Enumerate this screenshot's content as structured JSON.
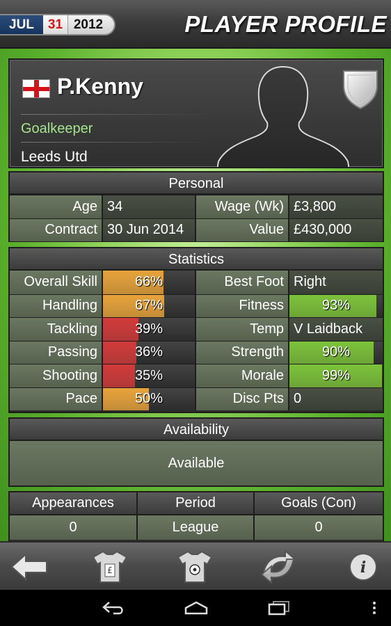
{
  "header": {
    "date": {
      "month": "JUL",
      "day": "31",
      "year": "2012"
    },
    "title": "PLAYER PROFILE"
  },
  "profile": {
    "name": "P.Kenny",
    "nationality_icon": "england-flag-icon",
    "position": "Goalkeeper",
    "club": "Leeds Utd"
  },
  "personal": {
    "title": "Personal",
    "rows": [
      {
        "l1": "Age",
        "v1": "34",
        "l2": "Wage (Wk)",
        "v2": "£3,800"
      },
      {
        "l1": "Contract",
        "v1": "30 Jun 2014",
        "l2": "Value",
        "v2": "£430,000"
      }
    ]
  },
  "statistics": {
    "title": "Statistics",
    "rows": [
      {
        "l1": "Overall Skill",
        "v1": "66%",
        "p1": 66,
        "c1": "#e8a33a",
        "l2": "Best Foot",
        "v2": "Right",
        "p2": null,
        "c2": ""
      },
      {
        "l1": "Handling",
        "v1": "67%",
        "p1": 67,
        "c1": "#e8a33a",
        "l2": "Fitness",
        "v2": "93%",
        "p2": 93,
        "c2": "#7cc23a"
      },
      {
        "l1": "Tackling",
        "v1": "39%",
        "p1": 39,
        "c1": "#d23a3a",
        "l2": "Temp",
        "v2": "V Laidback",
        "p2": null,
        "c2": ""
      },
      {
        "l1": "Passing",
        "v1": "36%",
        "p1": 36,
        "c1": "#d23a3a",
        "l2": "Strength",
        "v2": "90%",
        "p2": 90,
        "c2": "#7cc23a"
      },
      {
        "l1": "Shooting",
        "v1": "35%",
        "p1": 35,
        "c1": "#d23a3a",
        "l2": "Morale",
        "v2": "99%",
        "p2": 99,
        "c2": "#7cc23a"
      },
      {
        "l1": "Pace",
        "v1": "50%",
        "p1": 50,
        "c1": "#e8a33a",
        "l2": "Disc Pts",
        "v2": "0",
        "p2": null,
        "c2": ""
      }
    ]
  },
  "availability": {
    "title": "Availability",
    "status": "Available"
  },
  "appearances": {
    "headers": [
      "Appearances",
      "Period",
      "Goals (Con)"
    ],
    "row": [
      "0",
      "League",
      "0"
    ]
  },
  "toolbar": {
    "icons": [
      "back-arrow-icon",
      "shirt-finance-icon",
      "shirt-ball-icon",
      "swap-icon",
      "info-icon"
    ]
  },
  "android_nav": {
    "icons": [
      "nav-back-icon",
      "nav-home-icon",
      "nav-recents-icon",
      "nav-menu-icon"
    ]
  }
}
